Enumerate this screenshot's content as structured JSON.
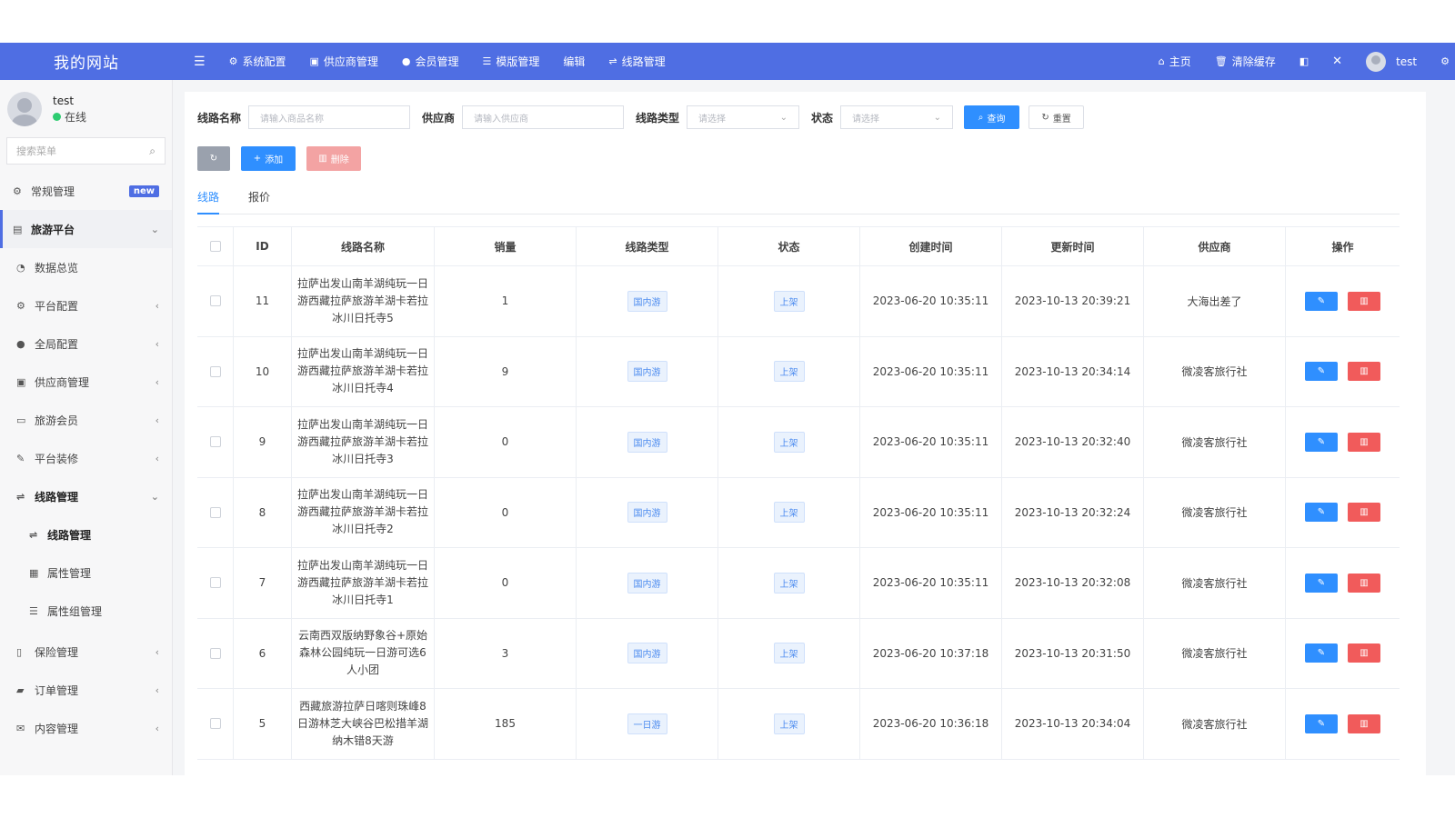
{
  "header": {
    "brand": "我的网站",
    "nav": [
      {
        "icon": "gear-icon",
        "glyph": "⚙",
        "label": "系统配置"
      },
      {
        "icon": "supplier-icon",
        "glyph": "▣",
        "label": "供应商管理"
      },
      {
        "icon": "user-icon",
        "glyph": "👤",
        "label": "会员管理"
      },
      {
        "icon": "list-icon",
        "glyph": "☰",
        "label": "模版管理"
      },
      {
        "icon": "",
        "glyph": "",
        "label": "编辑"
      },
      {
        "icon": "route-icon",
        "glyph": "⇌",
        "label": "线路管理"
      }
    ],
    "right": {
      "home": "主页",
      "clear_cache": "清除缓存",
      "username": "test"
    }
  },
  "sidebar": {
    "user": {
      "name": "test",
      "status": "在线"
    },
    "search_placeholder": "搜索菜单",
    "items": [
      {
        "label": "常规管理",
        "badge": "new"
      },
      {
        "label": "旅游平台"
      },
      {
        "label": "数据总览"
      },
      {
        "label": "平台配置"
      },
      {
        "label": "全局配置"
      },
      {
        "label": "供应商管理"
      },
      {
        "label": "旅游会员"
      },
      {
        "label": "平台装修"
      },
      {
        "label": "线路管理"
      },
      {
        "label": "线路管理"
      },
      {
        "label": "属性管理"
      },
      {
        "label": "属性组管理"
      },
      {
        "label": "保险管理"
      },
      {
        "label": "订单管理"
      },
      {
        "label": "内容管理"
      }
    ]
  },
  "filters": {
    "route_name_label": "线路名称",
    "route_name_placeholder": "请输入商品名称",
    "supplier_label": "供应商",
    "supplier_placeholder": "请输入供应商",
    "route_type_label": "线路类型",
    "route_type_placeholder": "请选择",
    "status_label": "状态",
    "status_placeholder": "请选择",
    "search_btn": "查询",
    "reset_btn": "重置"
  },
  "actions": {
    "add": "添加",
    "delete": "删除"
  },
  "tabs": [
    "线路",
    "报价"
  ],
  "table": {
    "columns": [
      "ID",
      "线路名称",
      "销量",
      "线路类型",
      "状态",
      "创建时间",
      "更新时间",
      "供应商",
      "操作"
    ],
    "rows": [
      {
        "id": "11",
        "name": "拉萨出发山南羊湖纯玩一日游西藏拉萨旅游羊湖卡若拉冰川日托寺5",
        "sales": "1",
        "type": "国内游",
        "status": "上架",
        "created": "2023-06-20 10:35:11",
        "updated": "2023-10-13 20:39:21",
        "supplier": "大海出差了"
      },
      {
        "id": "10",
        "name": "拉萨出发山南羊湖纯玩一日游西藏拉萨旅游羊湖卡若拉冰川日托寺4",
        "sales": "9",
        "type": "国内游",
        "status": "上架",
        "created": "2023-06-20 10:35:11",
        "updated": "2023-10-13 20:34:14",
        "supplier": "微凌客旅行社"
      },
      {
        "id": "9",
        "name": "拉萨出发山南羊湖纯玩一日游西藏拉萨旅游羊湖卡若拉冰川日托寺3",
        "sales": "0",
        "type": "国内游",
        "status": "上架",
        "created": "2023-06-20 10:35:11",
        "updated": "2023-10-13 20:32:40",
        "supplier": "微凌客旅行社"
      },
      {
        "id": "8",
        "name": "拉萨出发山南羊湖纯玩一日游西藏拉萨旅游羊湖卡若拉冰川日托寺2",
        "sales": "0",
        "type": "国内游",
        "status": "上架",
        "created": "2023-06-20 10:35:11",
        "updated": "2023-10-13 20:32:24",
        "supplier": "微凌客旅行社"
      },
      {
        "id": "7",
        "name": "拉萨出发山南羊湖纯玩一日游西藏拉萨旅游羊湖卡若拉冰川日托寺1",
        "sales": "0",
        "type": "国内游",
        "status": "上架",
        "created": "2023-06-20 10:35:11",
        "updated": "2023-10-13 20:32:08",
        "supplier": "微凌客旅行社"
      },
      {
        "id": "6",
        "name": "云南西双版纳野象谷+原始森林公园纯玩一日游可选6人小团",
        "sales": "3",
        "type": "国内游",
        "status": "上架",
        "created": "2023-06-20 10:37:18",
        "updated": "2023-10-13 20:31:50",
        "supplier": "微凌客旅行社"
      },
      {
        "id": "5",
        "name": "西藏旅游拉萨日喀则珠峰8日游林芝大峡谷巴松措羊湖纳木错8天游",
        "sales": "185",
        "type": "一日游",
        "status": "上架",
        "created": "2023-06-20 10:36:18",
        "updated": "2023-10-13 20:34:04",
        "supplier": "微凌客旅行社"
      }
    ]
  },
  "colors": {
    "topbar": "#4f6ee3",
    "primary": "#2f8fff",
    "danger": "#f15b5b",
    "online": "#2ecc71"
  }
}
